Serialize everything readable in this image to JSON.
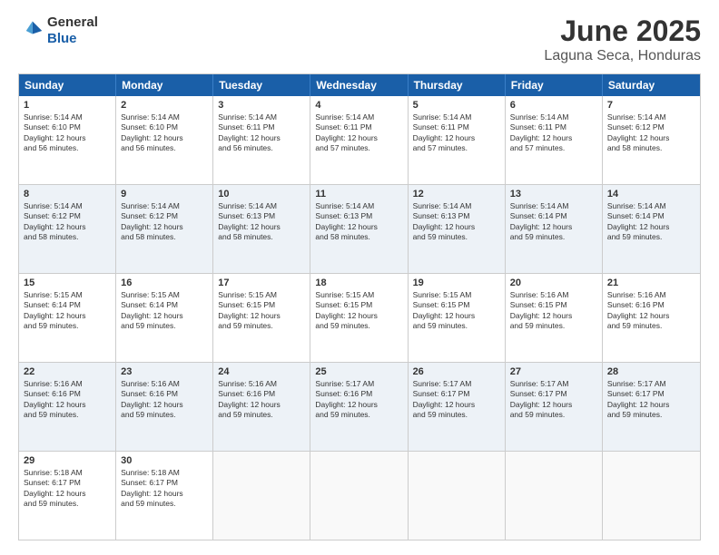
{
  "logo": {
    "line1": "General",
    "line2": "Blue"
  },
  "title": "June 2025",
  "subtitle": "Laguna Seca, Honduras",
  "days": [
    "Sunday",
    "Monday",
    "Tuesday",
    "Wednesday",
    "Thursday",
    "Friday",
    "Saturday"
  ],
  "rows": [
    [
      {
        "day": "",
        "data": ""
      },
      {
        "day": "2",
        "data": "Sunrise: 5:14 AM\nSunset: 6:10 PM\nDaylight: 12 hours\nand 56 minutes."
      },
      {
        "day": "3",
        "data": "Sunrise: 5:14 AM\nSunset: 6:11 PM\nDaylight: 12 hours\nand 56 minutes."
      },
      {
        "day": "4",
        "data": "Sunrise: 5:14 AM\nSunset: 6:11 PM\nDaylight: 12 hours\nand 57 minutes."
      },
      {
        "day": "5",
        "data": "Sunrise: 5:14 AM\nSunset: 6:11 PM\nDaylight: 12 hours\nand 57 minutes."
      },
      {
        "day": "6",
        "data": "Sunrise: 5:14 AM\nSunset: 6:11 PM\nDaylight: 12 hours\nand 57 minutes."
      },
      {
        "day": "7",
        "data": "Sunrise: 5:14 AM\nSunset: 6:12 PM\nDaylight: 12 hours\nand 58 minutes."
      }
    ],
    [
      {
        "day": "8",
        "data": "Sunrise: 5:14 AM\nSunset: 6:12 PM\nDaylight: 12 hours\nand 58 minutes."
      },
      {
        "day": "9",
        "data": "Sunrise: 5:14 AM\nSunset: 6:12 PM\nDaylight: 12 hours\nand 58 minutes."
      },
      {
        "day": "10",
        "data": "Sunrise: 5:14 AM\nSunset: 6:13 PM\nDaylight: 12 hours\nand 58 minutes."
      },
      {
        "day": "11",
        "data": "Sunrise: 5:14 AM\nSunset: 6:13 PM\nDaylight: 12 hours\nand 58 minutes."
      },
      {
        "day": "12",
        "data": "Sunrise: 5:14 AM\nSunset: 6:13 PM\nDaylight: 12 hours\nand 59 minutes."
      },
      {
        "day": "13",
        "data": "Sunrise: 5:14 AM\nSunset: 6:14 PM\nDaylight: 12 hours\nand 59 minutes."
      },
      {
        "day": "14",
        "data": "Sunrise: 5:14 AM\nSunset: 6:14 PM\nDaylight: 12 hours\nand 59 minutes."
      }
    ],
    [
      {
        "day": "15",
        "data": "Sunrise: 5:15 AM\nSunset: 6:14 PM\nDaylight: 12 hours\nand 59 minutes."
      },
      {
        "day": "16",
        "data": "Sunrise: 5:15 AM\nSunset: 6:14 PM\nDaylight: 12 hours\nand 59 minutes."
      },
      {
        "day": "17",
        "data": "Sunrise: 5:15 AM\nSunset: 6:15 PM\nDaylight: 12 hours\nand 59 minutes."
      },
      {
        "day": "18",
        "data": "Sunrise: 5:15 AM\nSunset: 6:15 PM\nDaylight: 12 hours\nand 59 minutes."
      },
      {
        "day": "19",
        "data": "Sunrise: 5:15 AM\nSunset: 6:15 PM\nDaylight: 12 hours\nand 59 minutes."
      },
      {
        "day": "20",
        "data": "Sunrise: 5:16 AM\nSunset: 6:15 PM\nDaylight: 12 hours\nand 59 minutes."
      },
      {
        "day": "21",
        "data": "Sunrise: 5:16 AM\nSunset: 6:16 PM\nDaylight: 12 hours\nand 59 minutes."
      }
    ],
    [
      {
        "day": "22",
        "data": "Sunrise: 5:16 AM\nSunset: 6:16 PM\nDaylight: 12 hours\nand 59 minutes."
      },
      {
        "day": "23",
        "data": "Sunrise: 5:16 AM\nSunset: 6:16 PM\nDaylight: 12 hours\nand 59 minutes."
      },
      {
        "day": "24",
        "data": "Sunrise: 5:16 AM\nSunset: 6:16 PM\nDaylight: 12 hours\nand 59 minutes."
      },
      {
        "day": "25",
        "data": "Sunrise: 5:17 AM\nSunset: 6:16 PM\nDaylight: 12 hours\nand 59 minutes."
      },
      {
        "day": "26",
        "data": "Sunrise: 5:17 AM\nSunset: 6:17 PM\nDaylight: 12 hours\nand 59 minutes."
      },
      {
        "day": "27",
        "data": "Sunrise: 5:17 AM\nSunset: 6:17 PM\nDaylight: 12 hours\nand 59 minutes."
      },
      {
        "day": "28",
        "data": "Sunrise: 5:17 AM\nSunset: 6:17 PM\nDaylight: 12 hours\nand 59 minutes."
      }
    ],
    [
      {
        "day": "29",
        "data": "Sunrise: 5:18 AM\nSunset: 6:17 PM\nDaylight: 12 hours\nand 59 minutes."
      },
      {
        "day": "30",
        "data": "Sunrise: 5:18 AM\nSunset: 6:17 PM\nDaylight: 12 hours\nand 59 minutes."
      },
      {
        "day": "",
        "data": ""
      },
      {
        "day": "",
        "data": ""
      },
      {
        "day": "",
        "data": ""
      },
      {
        "day": "",
        "data": ""
      },
      {
        "day": "",
        "data": ""
      }
    ]
  ],
  "first_row_special": {
    "day1": "1",
    "day1_data": "Sunrise: 5:14 AM\nSunset: 6:10 PM\nDaylight: 12 hours\nand 56 minutes."
  }
}
